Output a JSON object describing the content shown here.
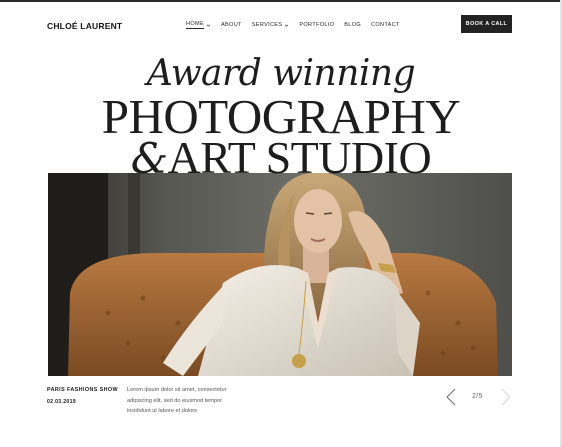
{
  "brand": {
    "logo": "CHLOÉ LAURENT"
  },
  "nav": {
    "items": [
      {
        "label": "HOME",
        "has_dropdown": true,
        "active": true
      },
      {
        "label": "ABOUT",
        "has_dropdown": false,
        "active": false
      },
      {
        "label": "SERVICES",
        "has_dropdown": true,
        "active": false
      },
      {
        "label": "PORTFOLIO",
        "has_dropdown": false,
        "active": false
      },
      {
        "label": "BLOG",
        "has_dropdown": false,
        "active": false
      },
      {
        "label": "CONTACT",
        "has_dropdown": false,
        "active": false
      }
    ],
    "cta_label": "BOOK A CALL"
  },
  "hero": {
    "line1": "Award winning",
    "line2": "PHOTOGRAPHY",
    "line3_amp": "&",
    "line3_text": "ART STUDIO"
  },
  "slide": {
    "title": "PARIS FASHIONS SHOW",
    "date": "02.03.2019",
    "description_lines": [
      "Lorem ipsum dolor sit amet, consectetur",
      "adipiscing elit, sed do eiusmod tempor",
      "incididunt ut labore et dolore"
    ],
    "counter": "2/5"
  },
  "icons": {
    "dropdown": "chevron-down-icon",
    "prev": "chevron-left-icon",
    "next": "chevron-right-icon"
  },
  "colors": {
    "cta_background": "#222222",
    "text": "#1d1d1d",
    "muted_text": "#555555"
  }
}
